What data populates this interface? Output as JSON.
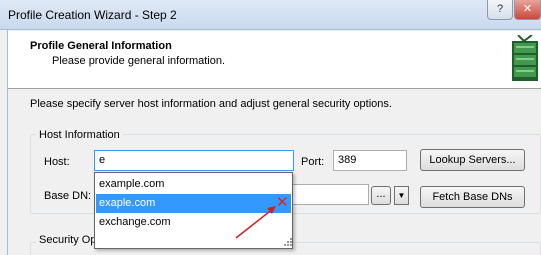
{
  "window": {
    "title": "Profile Creation Wizard - Step 2",
    "help_label": "?",
    "close_label": "✕"
  },
  "header": {
    "title": "Profile General Information",
    "subtitle": "Please provide general information."
  },
  "intro_text": "Please specify server host information and adjust general security options.",
  "host_group": {
    "label": "Host Information",
    "host_label": "Host:",
    "host_value": "e",
    "port_label": "Port:",
    "port_value": "389",
    "lookup_button": "Lookup Servers...",
    "basedn_label": "Base DN:",
    "basedn_value": "",
    "ellipsis_button": "...",
    "fetch_button": "Fetch Base DNs"
  },
  "autocomplete": {
    "items": [
      "example.com",
      "exaple.com",
      "exchange.com"
    ],
    "selected_index": 1,
    "delete_glyph": "✕"
  },
  "security_group": {
    "label": "Security Op"
  },
  "colors": {
    "selection": "#3399ff",
    "delete_mark": "#e02020",
    "annotation_arrow": "#d02020"
  },
  "icons": [
    "server-icon",
    "delete-icon",
    "resize-grip-icon",
    "annotation-arrow-icon",
    "dropdown-arrow-icon"
  ]
}
